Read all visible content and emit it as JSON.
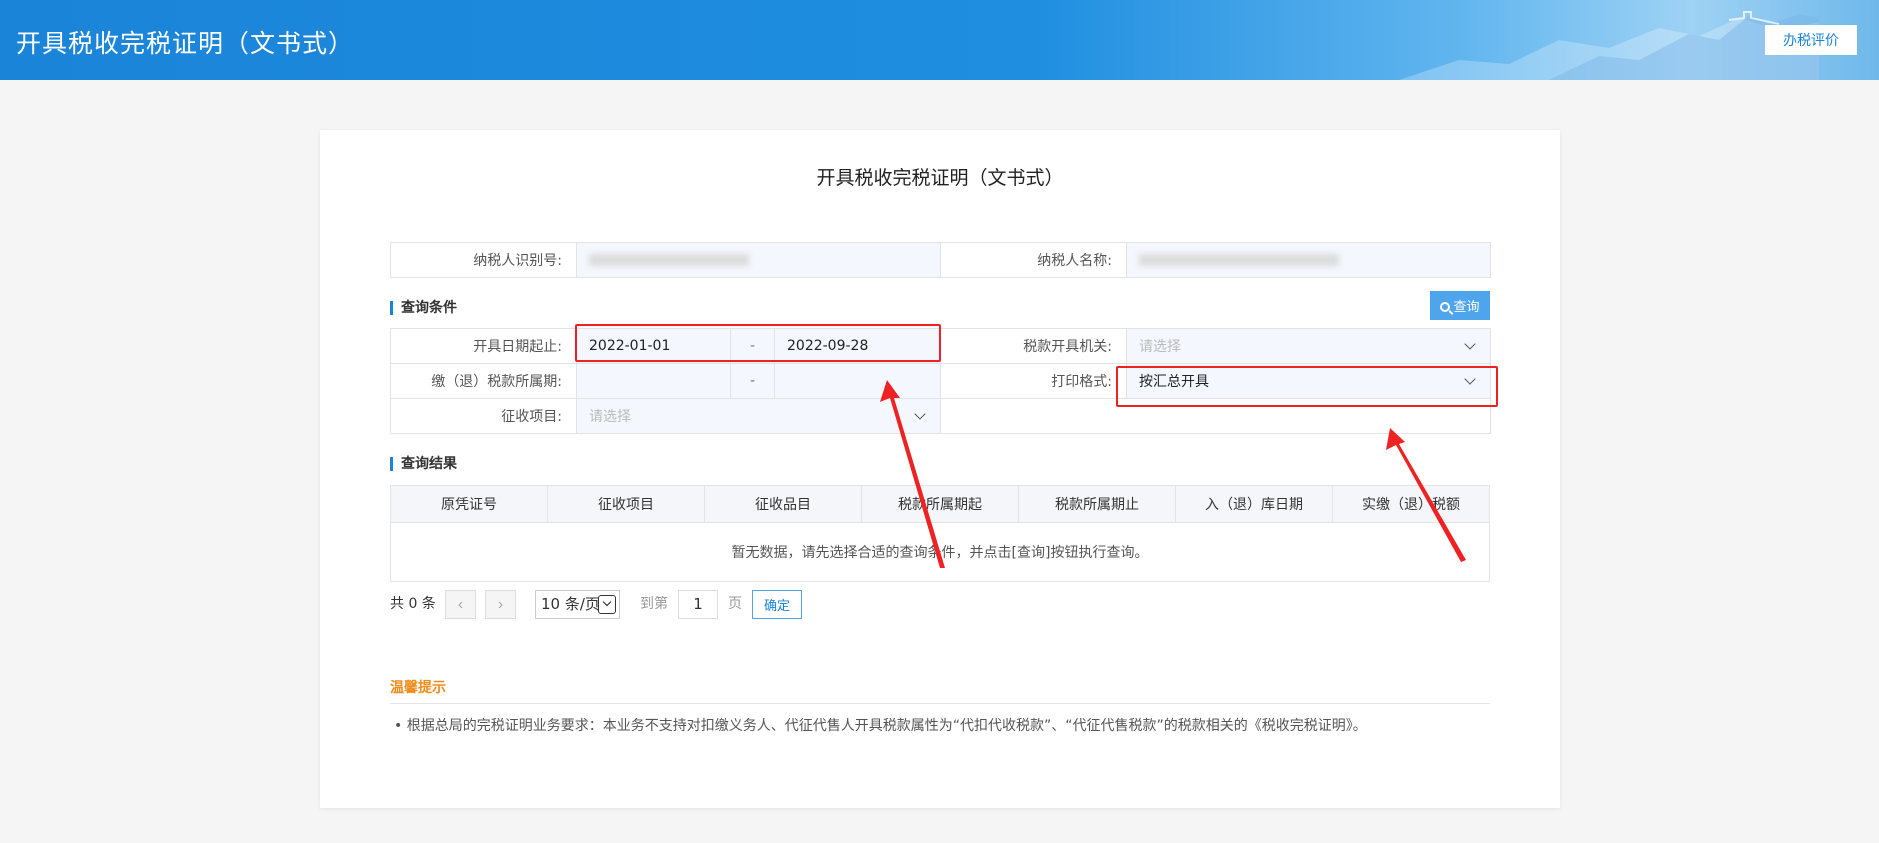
{
  "header": {
    "title": "开具税收完税证明（文书式）",
    "eval_button": "办税评价"
  },
  "card": {
    "title": "开具税收完税证明（文书式）"
  },
  "taxpayer": {
    "id_label": "纳税人识别号:",
    "name_label": "纳税人名称:"
  },
  "query": {
    "section_title": "查询条件",
    "button_label": "查询",
    "issue_date_label": "开具日期起止:",
    "issue_date_start": "2022-01-01",
    "issue_date_end": "2022-09-28",
    "range_sep": "-",
    "tax_office_label": "税款开具机关:",
    "tax_office_placeholder": "请选择",
    "period_label": "缴（退）税款所属期:",
    "print_format_label": "打印格式:",
    "print_format_value": "按汇总开具",
    "levy_item_label": "征收项目:",
    "levy_item_placeholder": "请选择"
  },
  "result": {
    "section_title": "查询结果",
    "columns": [
      "原凭证号",
      "征收项目",
      "征收品目",
      "税款所属期起",
      "税款所属期止",
      "入（退）库日期",
      "实缴（退）税额"
    ],
    "empty_message": "暂无数据，请先选择合适的查询条件，并点击[查询]按钮执行查询。"
  },
  "pager": {
    "total": "共 0 条",
    "prev": "‹",
    "next": "›",
    "page_size": "10 条/页",
    "goto_label": "到第",
    "page_value": "1",
    "page_suffix": "页",
    "confirm": "确定"
  },
  "tips": {
    "title": "温馨提示",
    "text": "• 根据总局的完税证明业务要求：本业务不支持对扣缴义务人、代征代售人开具税款属性为“代扣代收税款”、“代征代售税款”的税款相关的《税收完税证明》。"
  },
  "colors": {
    "header_blue": "#1a84d8",
    "annotation_red": "#ee2222",
    "tip_orange": "#f08c1a"
  }
}
